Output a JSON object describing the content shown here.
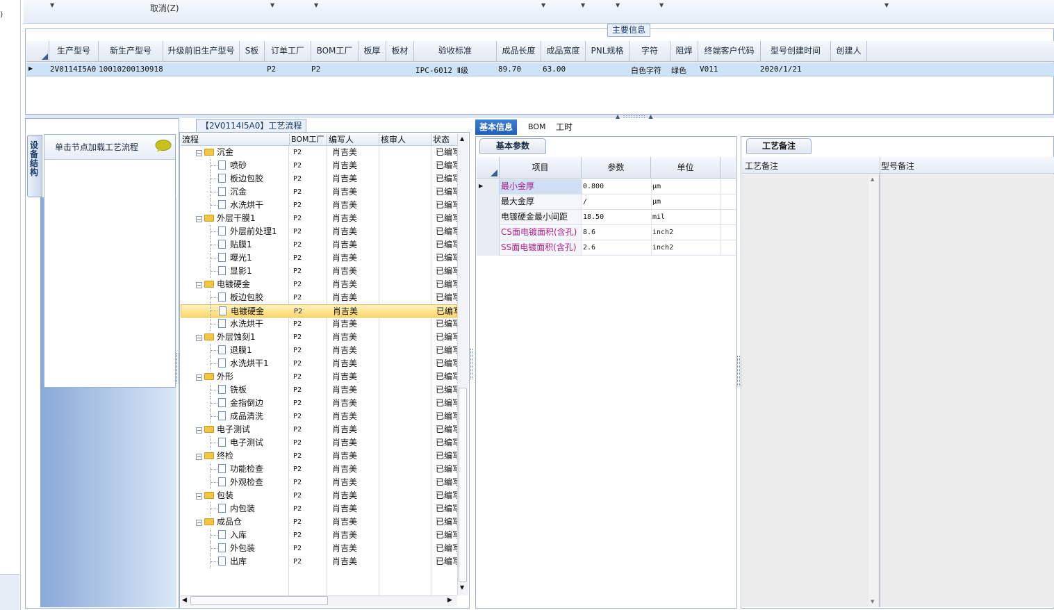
{
  "toolbar": {
    "cancel_label": "取消(Z)"
  },
  "left_strip": {
    "fragment": ")"
  },
  "main_info": {
    "legend": "主要信息",
    "columns": [
      "生产型号",
      "新生产型号",
      "升级前旧生产型号",
      "S板",
      "订单工厂",
      "BOM工厂",
      "板厚",
      "板材",
      "验收标准",
      "成品长度",
      "成品宽度",
      "PNL规格",
      "字符",
      "阻焊",
      "终端客户代码",
      "型号创建时间",
      "创建人"
    ],
    "row": {
      "c0": "2V0114I5A0",
      "c1": "10010200130918",
      "c2": "",
      "c3": "",
      "c4": "P2",
      "c5": "P2",
      "c6": "",
      "c7": "",
      "c8": "IPC-6012 Ⅱ级",
      "c9": "89.70",
      "c10": "63.00",
      "c11": "",
      "c12": "白色字符",
      "c13": "绿色",
      "c14": "V011",
      "c15": "2020/1/21",
      "c16": ""
    }
  },
  "device_panel": {
    "tab_label": "设备结构",
    "header": "单击节点加载工艺流程"
  },
  "process": {
    "legend": "【2V0114I5A0】工艺流程",
    "columns": [
      "流程",
      "BOM工厂",
      "编写人",
      "核审人",
      "状态"
    ],
    "rows": [
      {
        "level": 0,
        "name": "沉金",
        "bom": "P2",
        "writer": "肖吉美",
        "status": "已编写"
      },
      {
        "level": 1,
        "name": "喷砂",
        "bom": "P2",
        "writer": "肖吉美",
        "status": "已编写"
      },
      {
        "level": 1,
        "name": "板边包胶",
        "bom": "P2",
        "writer": "肖吉美",
        "status": "已编写"
      },
      {
        "level": 1,
        "name": "沉金",
        "bom": "P2",
        "writer": "肖吉美",
        "status": "已编写"
      },
      {
        "level": 1,
        "name": "水洗烘干",
        "bom": "P2",
        "writer": "肖吉美",
        "status": "已编写"
      },
      {
        "level": 0,
        "name": "外层干膜1",
        "bom": "P2",
        "writer": "肖吉美",
        "status": "已编写"
      },
      {
        "level": 1,
        "name": "外层前处理1",
        "bom": "P2",
        "writer": "肖吉美",
        "status": "已编写"
      },
      {
        "level": 1,
        "name": "贴膜1",
        "bom": "P2",
        "writer": "肖吉美",
        "status": "已编写"
      },
      {
        "level": 1,
        "name": "曝光1",
        "bom": "P2",
        "writer": "肖吉美",
        "status": "已编写"
      },
      {
        "level": 1,
        "name": "显影1",
        "bom": "P2",
        "writer": "肖吉美",
        "status": "已编写"
      },
      {
        "level": 0,
        "name": "电镀硬金",
        "bom": "P2",
        "writer": "肖吉美",
        "status": "已编写"
      },
      {
        "level": 1,
        "name": "板边包胶",
        "bom": "P2",
        "writer": "肖吉美",
        "status": "已编写"
      },
      {
        "level": 1,
        "name": "电镀硬金",
        "bom": "P2",
        "writer": "肖吉美",
        "status": "已编写",
        "selected": true
      },
      {
        "level": 1,
        "name": "水洗烘干",
        "bom": "P2",
        "writer": "肖吉美",
        "status": "已编写"
      },
      {
        "level": 0,
        "name": "外层蚀刻1",
        "bom": "P2",
        "writer": "肖吉美",
        "status": "已编写"
      },
      {
        "level": 1,
        "name": "退膜1",
        "bom": "P2",
        "writer": "肖吉美",
        "status": "已编写"
      },
      {
        "level": 1,
        "name": "水洗烘干1",
        "bom": "P2",
        "writer": "肖吉美",
        "status": "已编写"
      },
      {
        "level": 0,
        "name": "外形",
        "bom": "P2",
        "writer": "肖吉美",
        "status": "已编写"
      },
      {
        "level": 1,
        "name": "铣板",
        "bom": "P2",
        "writer": "肖吉美",
        "status": "已编写"
      },
      {
        "level": 1,
        "name": "金指倒边",
        "bom": "P2",
        "writer": "肖吉美",
        "status": "已编写"
      },
      {
        "level": 1,
        "name": "成品清洗",
        "bom": "P2",
        "writer": "肖吉美",
        "status": "已编写"
      },
      {
        "level": 0,
        "name": "电子测试",
        "bom": "P2",
        "writer": "肖吉美",
        "status": "已编写"
      },
      {
        "level": 1,
        "name": "电子测试",
        "bom": "P2",
        "writer": "肖吉美",
        "status": "已编写"
      },
      {
        "level": 0,
        "name": "终检",
        "bom": "P2",
        "writer": "肖吉美",
        "status": "已编写"
      },
      {
        "level": 1,
        "name": "功能检查",
        "bom": "P2",
        "writer": "肖吉美",
        "status": "已编写"
      },
      {
        "level": 1,
        "name": "外观检查",
        "bom": "P2",
        "writer": "肖吉美",
        "status": "已编写"
      },
      {
        "level": 0,
        "name": "包装",
        "bom": "P2",
        "writer": "肖吉美",
        "status": "已编写"
      },
      {
        "level": 1,
        "name": "内包装",
        "bom": "P2",
        "writer": "肖吉美",
        "status": "已编写"
      },
      {
        "level": 0,
        "name": "成品仓",
        "bom": "P2",
        "writer": "肖吉美",
        "status": "已编写"
      },
      {
        "level": 1,
        "name": "入库",
        "bom": "P2",
        "writer": "肖吉美",
        "status": "已编写"
      },
      {
        "level": 1,
        "name": "外包装",
        "bom": "P2",
        "writer": "肖吉美",
        "status": "已编写"
      },
      {
        "level": 1,
        "name": "出库",
        "bom": "P2",
        "writer": "肖吉美",
        "status": "已编写"
      }
    ]
  },
  "detail_tabs": [
    "基本信息",
    "BOM",
    "工时"
  ],
  "basic_params": {
    "title": "基本参数",
    "columns": [
      "项目",
      "参数",
      "单位"
    ],
    "rows": [
      {
        "item": "最小金厚",
        "value": "0.800",
        "unit": "μm",
        "color": "#b0208a",
        "highlight": true
      },
      {
        "item": "最大金厚",
        "value": "/",
        "unit": "μm",
        "color": "#111111"
      },
      {
        "item": "电镀硬金最小间距",
        "value": "18.50",
        "unit": "mil",
        "color": "#111111"
      },
      {
        "item": "CS面电镀面积(含孔)",
        "value": "8.6",
        "unit": "inch2",
        "color": "#b0208a"
      },
      {
        "item": "SS面电镀面积(含孔)",
        "value": "2.6",
        "unit": "inch2",
        "color": "#b0208a"
      }
    ]
  },
  "notes": {
    "title": "工艺备注",
    "col1": "工艺备注",
    "col2": "型号备注"
  },
  "colors": {
    "accent": "#1f5fb6",
    "selection": "#ffd766",
    "row_highlight": "#cfe3f7",
    "magenta": "#b0208a"
  }
}
